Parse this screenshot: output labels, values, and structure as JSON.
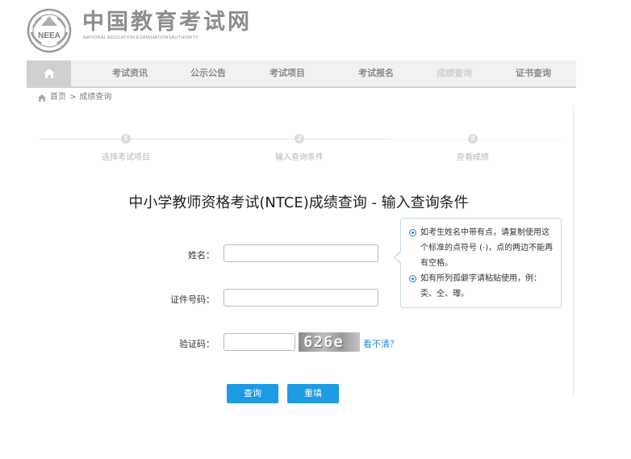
{
  "header": {
    "site_name": "中国教育考试网",
    "site_name_en": "NATIONAL EDUCATION EXAMINATIONSAUTHORITY",
    "logo_text": "NEEA",
    "logo_icon": "neea-emblem-icon"
  },
  "nav": {
    "home_icon": "home-icon",
    "items": [
      {
        "label": "考试资讯"
      },
      {
        "label": "公示公告"
      },
      {
        "label": "考试项目"
      },
      {
        "label": "考试报名"
      },
      {
        "label": "成绩查询",
        "active": true
      },
      {
        "label": "证书查询"
      }
    ]
  },
  "breadcrumb": {
    "home_icon": "home-icon",
    "home": "首页",
    "separator": ">",
    "current": "成绩查询"
  },
  "steps": [
    {
      "number": "1",
      "label": "选择考试项目"
    },
    {
      "number": "2",
      "label": "输入查询条件"
    },
    {
      "number": "3",
      "label": "查看成绩"
    }
  ],
  "title": "中小学教师资格考试(NTCE)成绩查询 - 输入查询条件",
  "form": {
    "name_label": "姓名：",
    "name_value": "",
    "id_label": "证件号码：",
    "id_value": "",
    "captcha_label": "验证码：",
    "captcha_value": "",
    "captcha_text": "626e",
    "refresh_label": "看不清？"
  },
  "tip": {
    "items": [
      "如考生姓名中带有点，请复制使用这个标准的点符号 (·)，点的两边不能再有空格。",
      "如有所列孤僻字请粘贴使用，例：奀、仝、瓈。"
    ]
  },
  "buttons": {
    "query": "查询",
    "reset": "重填"
  },
  "colors": {
    "accent": "#1d9be3",
    "nav_bg": "#f1f1f1",
    "home_bg": "#cfcfcf",
    "tip_border": "#c4daea"
  }
}
